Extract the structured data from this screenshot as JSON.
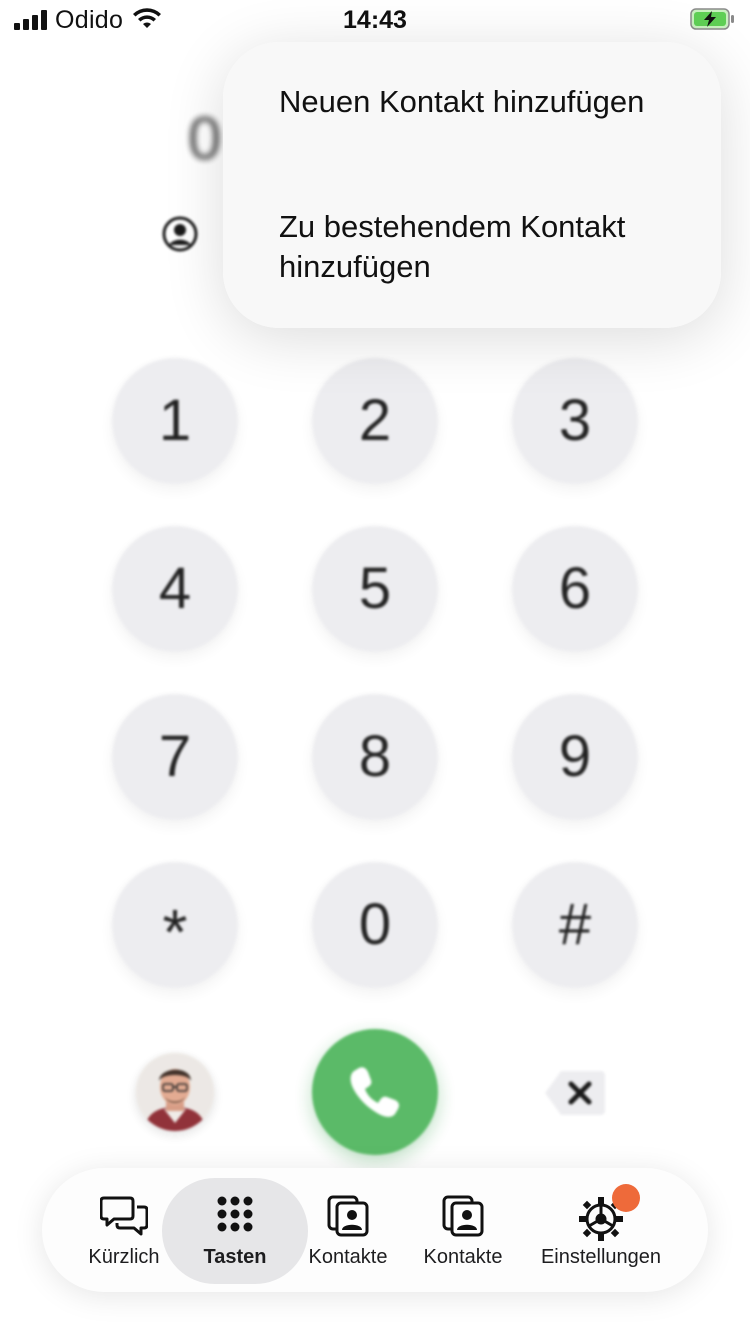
{
  "status_bar": {
    "carrier": "Odido",
    "time": "14:43"
  },
  "number_display": {
    "value": "0"
  },
  "menu": {
    "items": [
      {
        "label": "Neuen Kontakt hinzufügen"
      },
      {
        "label": "Zu bestehendem Kontakt hinzufügen"
      }
    ]
  },
  "keypad": {
    "keys": [
      {
        "label": "1"
      },
      {
        "label": "2"
      },
      {
        "label": "3"
      },
      {
        "label": "4"
      },
      {
        "label": "5"
      },
      {
        "label": "6"
      },
      {
        "label": "7"
      },
      {
        "label": "8"
      },
      {
        "label": "9"
      },
      {
        "label": "*"
      },
      {
        "label": "0"
      },
      {
        "label": "#"
      }
    ]
  },
  "tabbar": {
    "tabs": [
      {
        "label": "Kürzlich",
        "icon": "chat-bubbles-icon"
      },
      {
        "label": "Tasten",
        "icon": "keypad-grid-icon",
        "active": true
      },
      {
        "label": "Kontakte",
        "icon": "contacts-icon"
      },
      {
        "label": "Kontakte",
        "icon": "contacts-icon"
      },
      {
        "label": "Einstellungen",
        "icon": "gear-icon",
        "badge": true
      }
    ]
  },
  "colors": {
    "call_button": "#55b862",
    "key_background": "#ededf0",
    "badge": "#ee6a3a"
  }
}
